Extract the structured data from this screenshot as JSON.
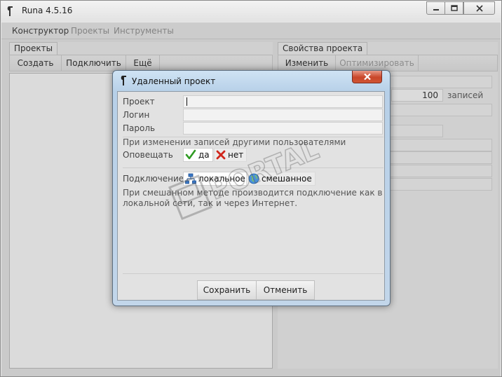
{
  "window": {
    "title": "Runa 4.5.16"
  },
  "menu": [
    {
      "label": "Конструктор",
      "state": "active"
    },
    {
      "label": "Проекты",
      "state": "disabled"
    },
    {
      "label": "Инструменты",
      "state": "disabled"
    }
  ],
  "left_panel": {
    "tab": "Проекты",
    "toolbar": [
      "Создать",
      "Подключить",
      "Ещё"
    ]
  },
  "right_panel": {
    "tab": "Свойства проекта",
    "toolbar": {
      "edit": "Изменить",
      "optimize": "Оптимизировать"
    },
    "records_count": "100",
    "records_unit": "записей"
  },
  "dialog": {
    "title": "Удаленный проект",
    "fields": {
      "project": {
        "label": "Проект",
        "value": ""
      },
      "login": {
        "label": "Логин",
        "value": ""
      },
      "password": {
        "label": "Пароль",
        "value": ""
      }
    },
    "notify": {
      "caption": "При изменении записей другими пользователями",
      "label": "Оповещать",
      "yes": "да",
      "no": "нет"
    },
    "connection": {
      "label": "Подключение",
      "local": "локальное",
      "mixed": "смешанное",
      "hint_line1": "При смешанном методе производится подключение как в",
      "hint_line2": "локальной сети, так и через Интернет."
    },
    "buttons": {
      "save": "Сохранить",
      "cancel": "Отменить"
    }
  },
  "watermark": "PORTAL",
  "colors": {
    "check_green": "#2e9a22",
    "cross_red": "#d0261b",
    "close_red": "#c9452a"
  }
}
